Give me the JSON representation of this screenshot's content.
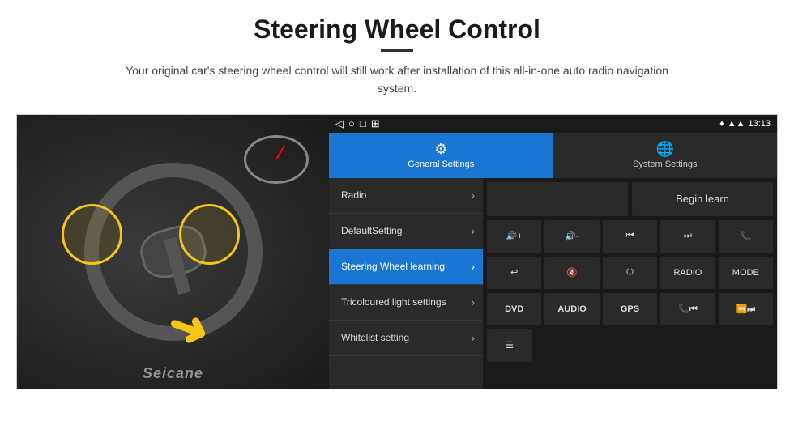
{
  "header": {
    "title": "Steering Wheel Control",
    "subtitle": "Your original car's steering wheel control will still work after installation of this all-in-one auto radio navigation system."
  },
  "status_bar": {
    "nav_back": "◁",
    "nav_home": "○",
    "nav_square": "□",
    "nav_grid": "⊞",
    "signal_icon": "▲",
    "wifi_icon": "▲",
    "time": "13:13",
    "location_icon": "♦"
  },
  "tabs": [
    {
      "id": "general",
      "label": "General Settings",
      "icon": "⚙",
      "active": true
    },
    {
      "id": "system",
      "label": "System Settings",
      "icon": "🌐",
      "active": false
    }
  ],
  "menu_items": [
    {
      "label": "Radio",
      "active": false
    },
    {
      "label": "DefaultSetting",
      "active": false
    },
    {
      "label": "Steering Wheel learning",
      "active": true
    },
    {
      "label": "Tricoloured light settings",
      "active": false
    },
    {
      "label": "Whitelist setting",
      "active": false
    }
  ],
  "begin_learn_label": "Begin learn",
  "function_buttons": {
    "row1": [
      {
        "icon": "🔊+",
        "label": "vol+"
      },
      {
        "icon": "🔊-",
        "label": "vol-"
      },
      {
        "icon": "⏮",
        "label": "prev"
      },
      {
        "icon": "⏭",
        "label": "next"
      },
      {
        "icon": "📞",
        "label": "call"
      }
    ],
    "row2": [
      {
        "icon": "↩",
        "label": "back"
      },
      {
        "icon": "🔇",
        "label": "mute"
      },
      {
        "icon": "⏻",
        "label": "power"
      },
      {
        "icon": "RADIO",
        "label": "radio"
      },
      {
        "icon": "MODE",
        "label": "mode"
      }
    ],
    "row3_labels": [
      "DVD",
      "AUDIO",
      "GPS",
      "📞⏮",
      "⏪⏭"
    ],
    "row4": [
      {
        "icon": "☰",
        "label": "menu"
      }
    ]
  },
  "seicane": "Seicane"
}
